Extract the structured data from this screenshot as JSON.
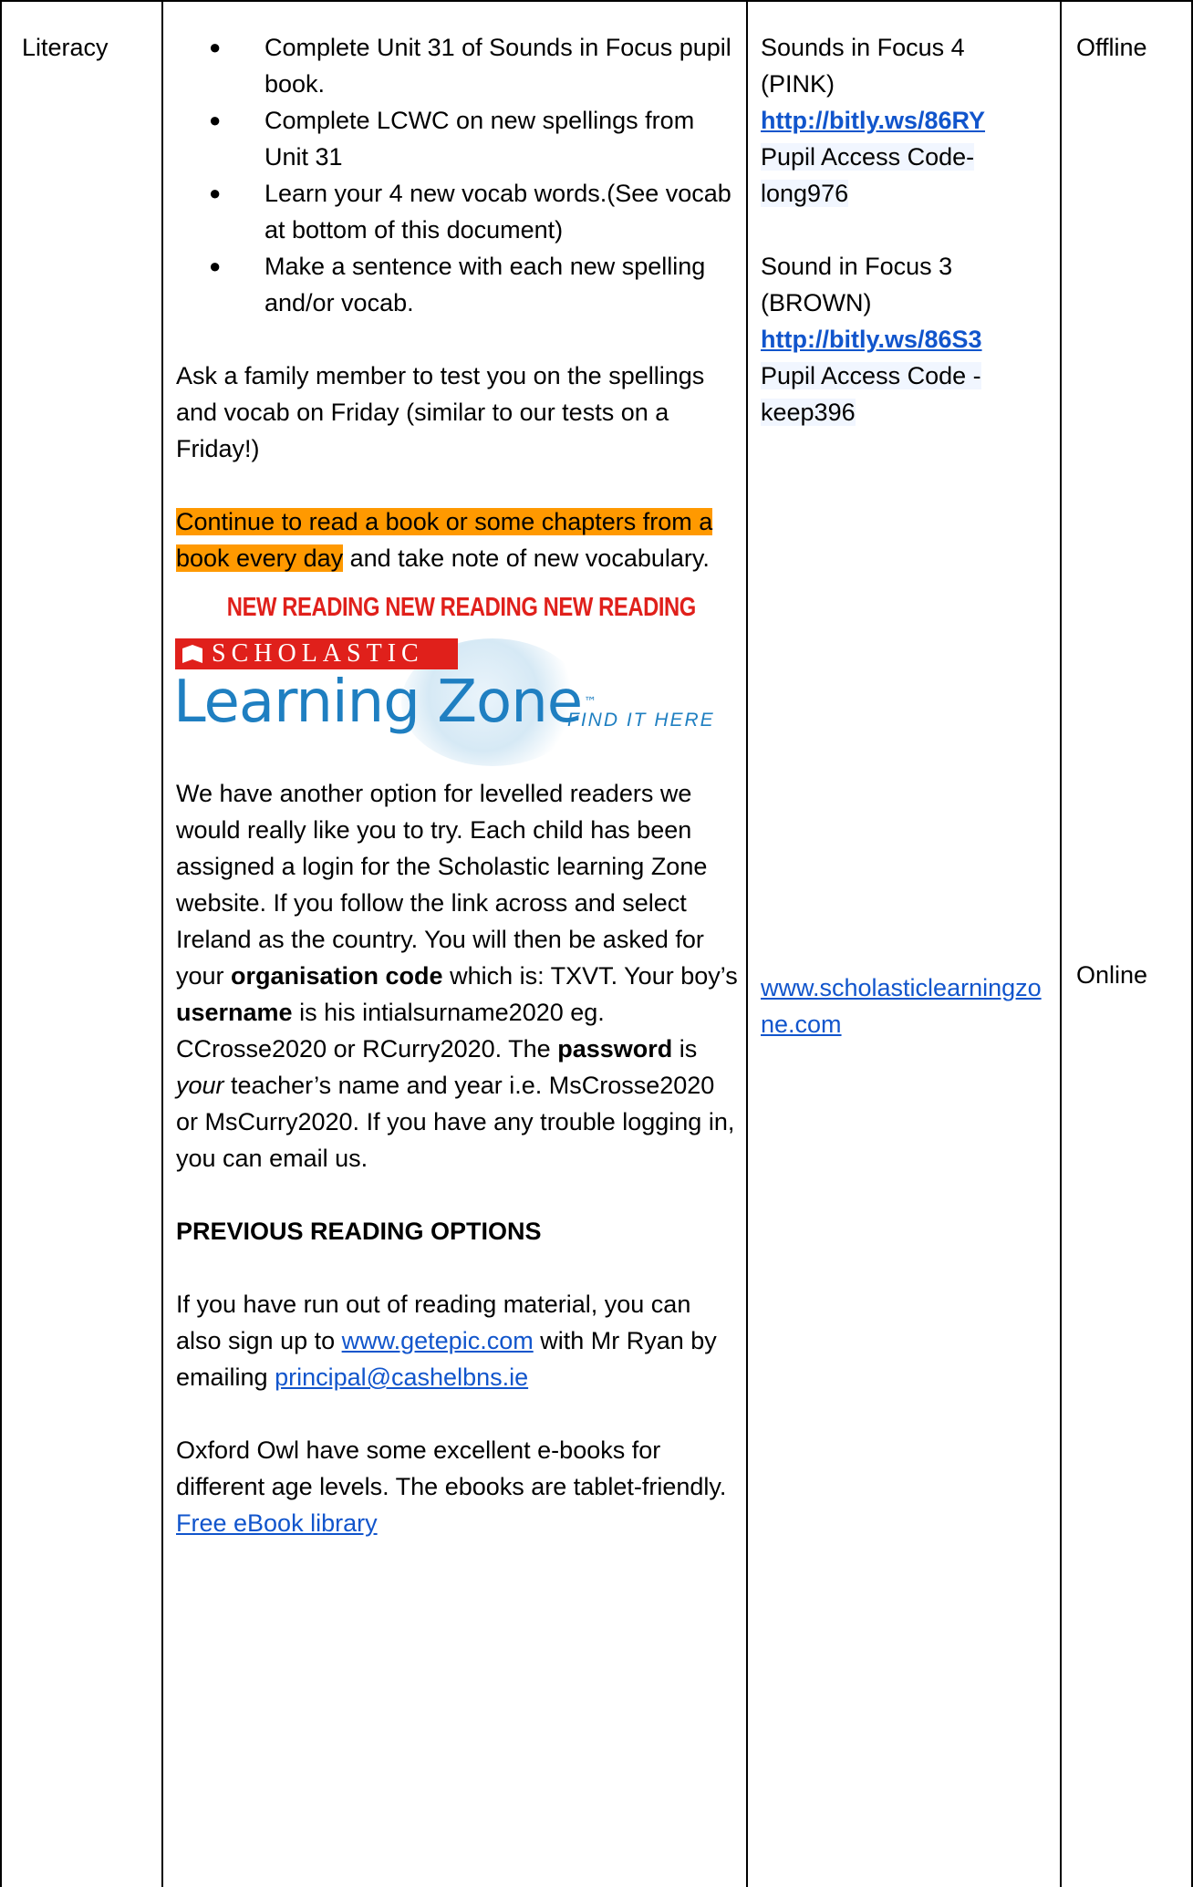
{
  "subject": "Literacy",
  "tasks": [
    "Complete Unit 31 of Sounds in Focus pupil book.",
    "Complete LCWC on new spellings from Unit 31",
    "Learn your 4 new vocab words.(See vocab at bottom of this document)",
    "Make a sentence with each new spelling and/or vocab."
  ],
  "test_note": "Ask a family member to test you on the spellings and vocab on Friday (similar to our tests on a Friday!)",
  "reading_highlight": "Continue to read a book or some chapters from a book every day",
  "reading_rest": " and take note of new vocabulary.",
  "new_reading_banner": "NEW READING  NEW READING  NEW READING",
  "logo": {
    "brand": "SCHOLASTIC",
    "product": "Learning Zone",
    "tm": "™",
    "cta": "FIND IT HERE"
  },
  "lz_paragraph": {
    "p1": "We have another option for levelled readers we would really like you to try. Each child has been assigned a login for the Scholastic learning Zone website. If you follow the link across and select Ireland as the country. You will then be asked for your ",
    "b1": "organisation code",
    "p2": " which is: TXVT. Your boy’s ",
    "b2": "username",
    "p3": " is his intialsurname2020 eg. CCrosse2020 or RCurry2020. The ",
    "b3": "password",
    "p4": " is ",
    "i1": "your",
    "p5": " teacher’s name and year i.e.  MsCrosse2020 or MsCurry2020. If you have any trouble logging in, you can email us."
  },
  "prev_heading": "PREVIOUS READING OPTIONS",
  "prev_para": {
    "p1": "If you have run out of reading material, you can also sign up to ",
    "link1": "www.getepic.com",
    "p2": " with Mr Ryan by emailing ",
    "link2": "principal@cashelbns.ie"
  },
  "oxford_para": "Oxford Owl have some excellent e-books for different age levels. The ebooks are tablet-friendly.",
  "oxford_link": "Free eBook library",
  "resources": {
    "sif4_title": "Sounds in Focus 4 (PINK)",
    "sif4_link": "http://bitly.ws/86RY",
    "sif4_code": "Pupil  Access Code- long976",
    "sif3_title": "Sound in Focus 3 (BROWN)",
    "sif3_link": "http://bitly.ws/86S3",
    "sif3_code": "Pupil Access Code - keep396",
    "lz_link": "www.scholasticlearningzone.com"
  },
  "mode_offline": "Offline",
  "mode_online": "Online"
}
